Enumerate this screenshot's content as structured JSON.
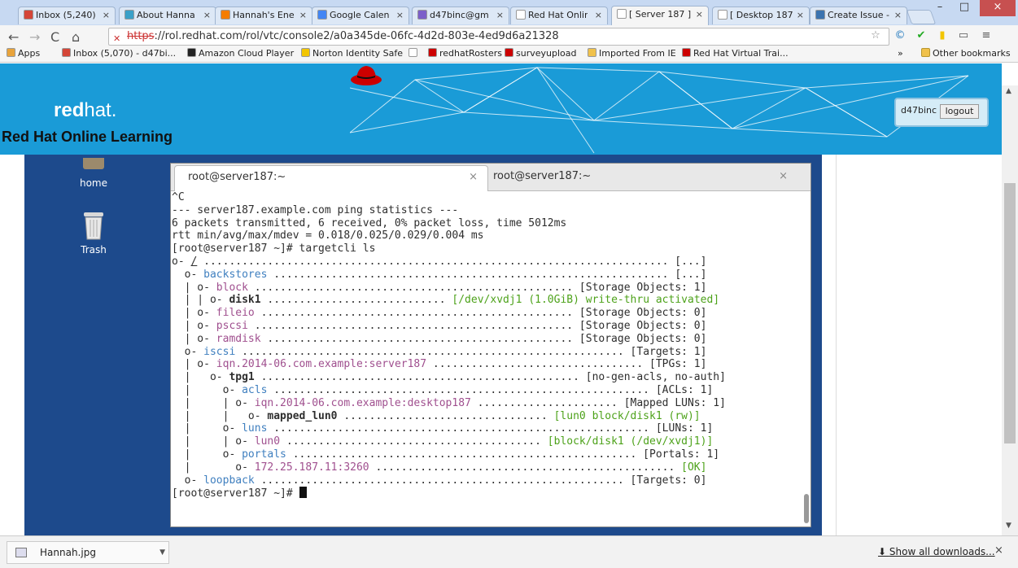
{
  "browser": {
    "tabs": [
      {
        "label": "Inbox (5,240)",
        "icon": "gmail-icon",
        "color": "#d44638"
      },
      {
        "label": "About Hanna",
        "icon": "link-icon",
        "color": "#3aa0c8"
      },
      {
        "label": "Hannah's Ene",
        "icon": "b-icon",
        "color": "#f57d00"
      },
      {
        "label": "Google Calen",
        "icon": "calendar-icon",
        "color": "#4285f4"
      },
      {
        "label": "d47binc@gm",
        "icon": "mail-icon",
        "color": "#7b5fc9"
      },
      {
        "label": "Red Hat Onlir",
        "icon": "page-icon",
        "color": "#ffffff"
      },
      {
        "label": "[ Server 187 ]",
        "icon": "page-icon",
        "color": "#ffffff"
      },
      {
        "label": "[ Desktop 187",
        "icon": "page-icon",
        "color": "#ffffff"
      },
      {
        "label": "Create Issue -",
        "icon": "jira-icon",
        "color": "#3b73af"
      }
    ],
    "active_tab": 6,
    "url_scheme": "https",
    "url_rest": "://rol.redhat.com/rol/vtc/console2/a0a345de-06fc-4d2d-803e-4ed9d6a21328",
    "bookmarks": [
      {
        "label": "Apps",
        "icon": "apps-icon",
        "color": "#e8a33b"
      },
      {
        "label": "Inbox (5,070) - d47bi...",
        "icon": "gmail-icon",
        "color": "#d44638"
      },
      {
        "label": "Amazon Cloud Player",
        "icon": "amazon-icon",
        "color": "#222222"
      },
      {
        "label": "Norton Identity Safe",
        "icon": "norton-icon",
        "color": "#f2c500"
      },
      {
        "label": "",
        "icon": "page-icon",
        "color": "#ffffff"
      },
      {
        "label": "redhatRosters",
        "icon": "redhat-icon",
        "color": "#cc0000"
      },
      {
        "label": "surveyupload",
        "icon": "redhat-icon",
        "color": "#cc0000"
      },
      {
        "label": "Imported From IE",
        "icon": "folder-icon",
        "color": "#f0c14b"
      },
      {
        "label": "Red Hat Virtual Trai...",
        "icon": "redhat-icon",
        "color": "#cc0000"
      }
    ],
    "overflow_label": "»",
    "other_bookmarks": "Other bookmarks"
  },
  "site": {
    "brand_red": "red",
    "brand_hat": "hat.",
    "title": "Red Hat Online Learning",
    "username": "d47binc",
    "logout_label": "logout",
    "banner_color": "#1a9bd7"
  },
  "desktop": {
    "icons": [
      {
        "label": "home"
      },
      {
        "label": "Trash"
      }
    ]
  },
  "terminal": {
    "tabs": [
      {
        "label": "root@server187:~"
      },
      {
        "label": "root@server187:~"
      }
    ],
    "lines": [
      [
        {
          "t": "^C"
        }
      ],
      [
        {
          "t": "--- server187.example.com ping statistics ---"
        }
      ],
      [
        {
          "t": "6 packets transmitted, 6 received, 0% packet loss, time 5012ms"
        }
      ],
      [
        {
          "t": "rtt min/avg/max/mdev = 0.018/0.025/0.029/0.004 ms"
        }
      ],
      [
        {
          "t": "[root@server187 ~]# targetcli ls"
        }
      ],
      [
        {
          "t": "o- "
        },
        {
          "t": "/",
          "c": "u"
        },
        {
          "t": " ......................................................................... [...]"
        }
      ],
      [
        {
          "t": "  o- "
        },
        {
          "t": "backstores",
          "c": "blue"
        },
        {
          "t": " .............................................................. [...]"
        }
      ],
      [
        {
          "t": "  | o- "
        },
        {
          "t": "block",
          "c": "purple"
        },
        {
          "t": " .................................................. [Storage Objects: 1]"
        }
      ],
      [
        {
          "t": "  | | o- "
        },
        {
          "t": "disk1",
          "c": "b"
        },
        {
          "t": " ............................ "
        },
        {
          "t": "[/dev/xvdj1 (1.0GiB) write-thru activated]",
          "c": "green"
        }
      ],
      [
        {
          "t": "  | o- "
        },
        {
          "t": "fileio",
          "c": "purple"
        },
        {
          "t": " ................................................. [Storage Objects: 0]"
        }
      ],
      [
        {
          "t": "  | o- "
        },
        {
          "t": "pscsi",
          "c": "purple"
        },
        {
          "t": " .................................................. [Storage Objects: 0]"
        }
      ],
      [
        {
          "t": "  | o- "
        },
        {
          "t": "ramdisk",
          "c": "purple"
        },
        {
          "t": " ................................................ [Storage Objects: 0]"
        }
      ],
      [
        {
          "t": "  o- "
        },
        {
          "t": "iscsi",
          "c": "blue"
        },
        {
          "t": " ............................................................ [Targets: 1]"
        }
      ],
      [
        {
          "t": "  | o- "
        },
        {
          "t": "iqn.2014-06.com.example:server187",
          "c": "purple"
        },
        {
          "t": " ................................. [TPGs: 1]"
        }
      ],
      [
        {
          "t": "  |   o- "
        },
        {
          "t": "tpg1",
          "c": "b"
        },
        {
          "t": " .................................................. [no-gen-acls, no-auth]"
        }
      ],
      [
        {
          "t": "  |     o- "
        },
        {
          "t": "acls",
          "c": "blue"
        },
        {
          "t": " ........................................................... [ACLs: 1]"
        }
      ],
      [
        {
          "t": "  |     | o- "
        },
        {
          "t": "iqn.2014-06.com.example:desktop187",
          "c": "purple"
        },
        {
          "t": " ...................... [Mapped LUNs: 1]"
        }
      ],
      [
        {
          "t": "  |     |   o- "
        },
        {
          "t": "mapped_lun0",
          "c": "b"
        },
        {
          "t": " ................................ "
        },
        {
          "t": "[lun0 block/disk1 (rw)]",
          "c": "green"
        }
      ],
      [
        {
          "t": "  |     o- "
        },
        {
          "t": "luns",
          "c": "blue"
        },
        {
          "t": " ........................................................... [LUNs: 1]"
        }
      ],
      [
        {
          "t": "  |     | o- "
        },
        {
          "t": "lun0",
          "c": "purple"
        },
        {
          "t": " ........................................ "
        },
        {
          "t": "[block/disk1 (/dev/xvdj1)]",
          "c": "green"
        }
      ],
      [
        {
          "t": "  |     o- "
        },
        {
          "t": "portals",
          "c": "blue"
        },
        {
          "t": " ...................................................... [Portals: 1]"
        }
      ],
      [
        {
          "t": "  |       o- "
        },
        {
          "t": "172.25.187.11:3260",
          "c": "purple"
        },
        {
          "t": " ............................................... "
        },
        {
          "t": "[OK]",
          "c": "green"
        }
      ],
      [
        {
          "t": "  o- "
        },
        {
          "t": "loopback",
          "c": "blue"
        },
        {
          "t": " ......................................................... [Targets: 0]"
        }
      ],
      [
        {
          "t": "[root@server187 ~]# "
        },
        {
          "cursor": true
        }
      ]
    ]
  },
  "downloads": {
    "file": "Hannah.jpg",
    "show_all": "Show all downloads...",
    "close": "×"
  },
  "window": {
    "minimize": "–",
    "maximize": "□",
    "close": "×"
  }
}
